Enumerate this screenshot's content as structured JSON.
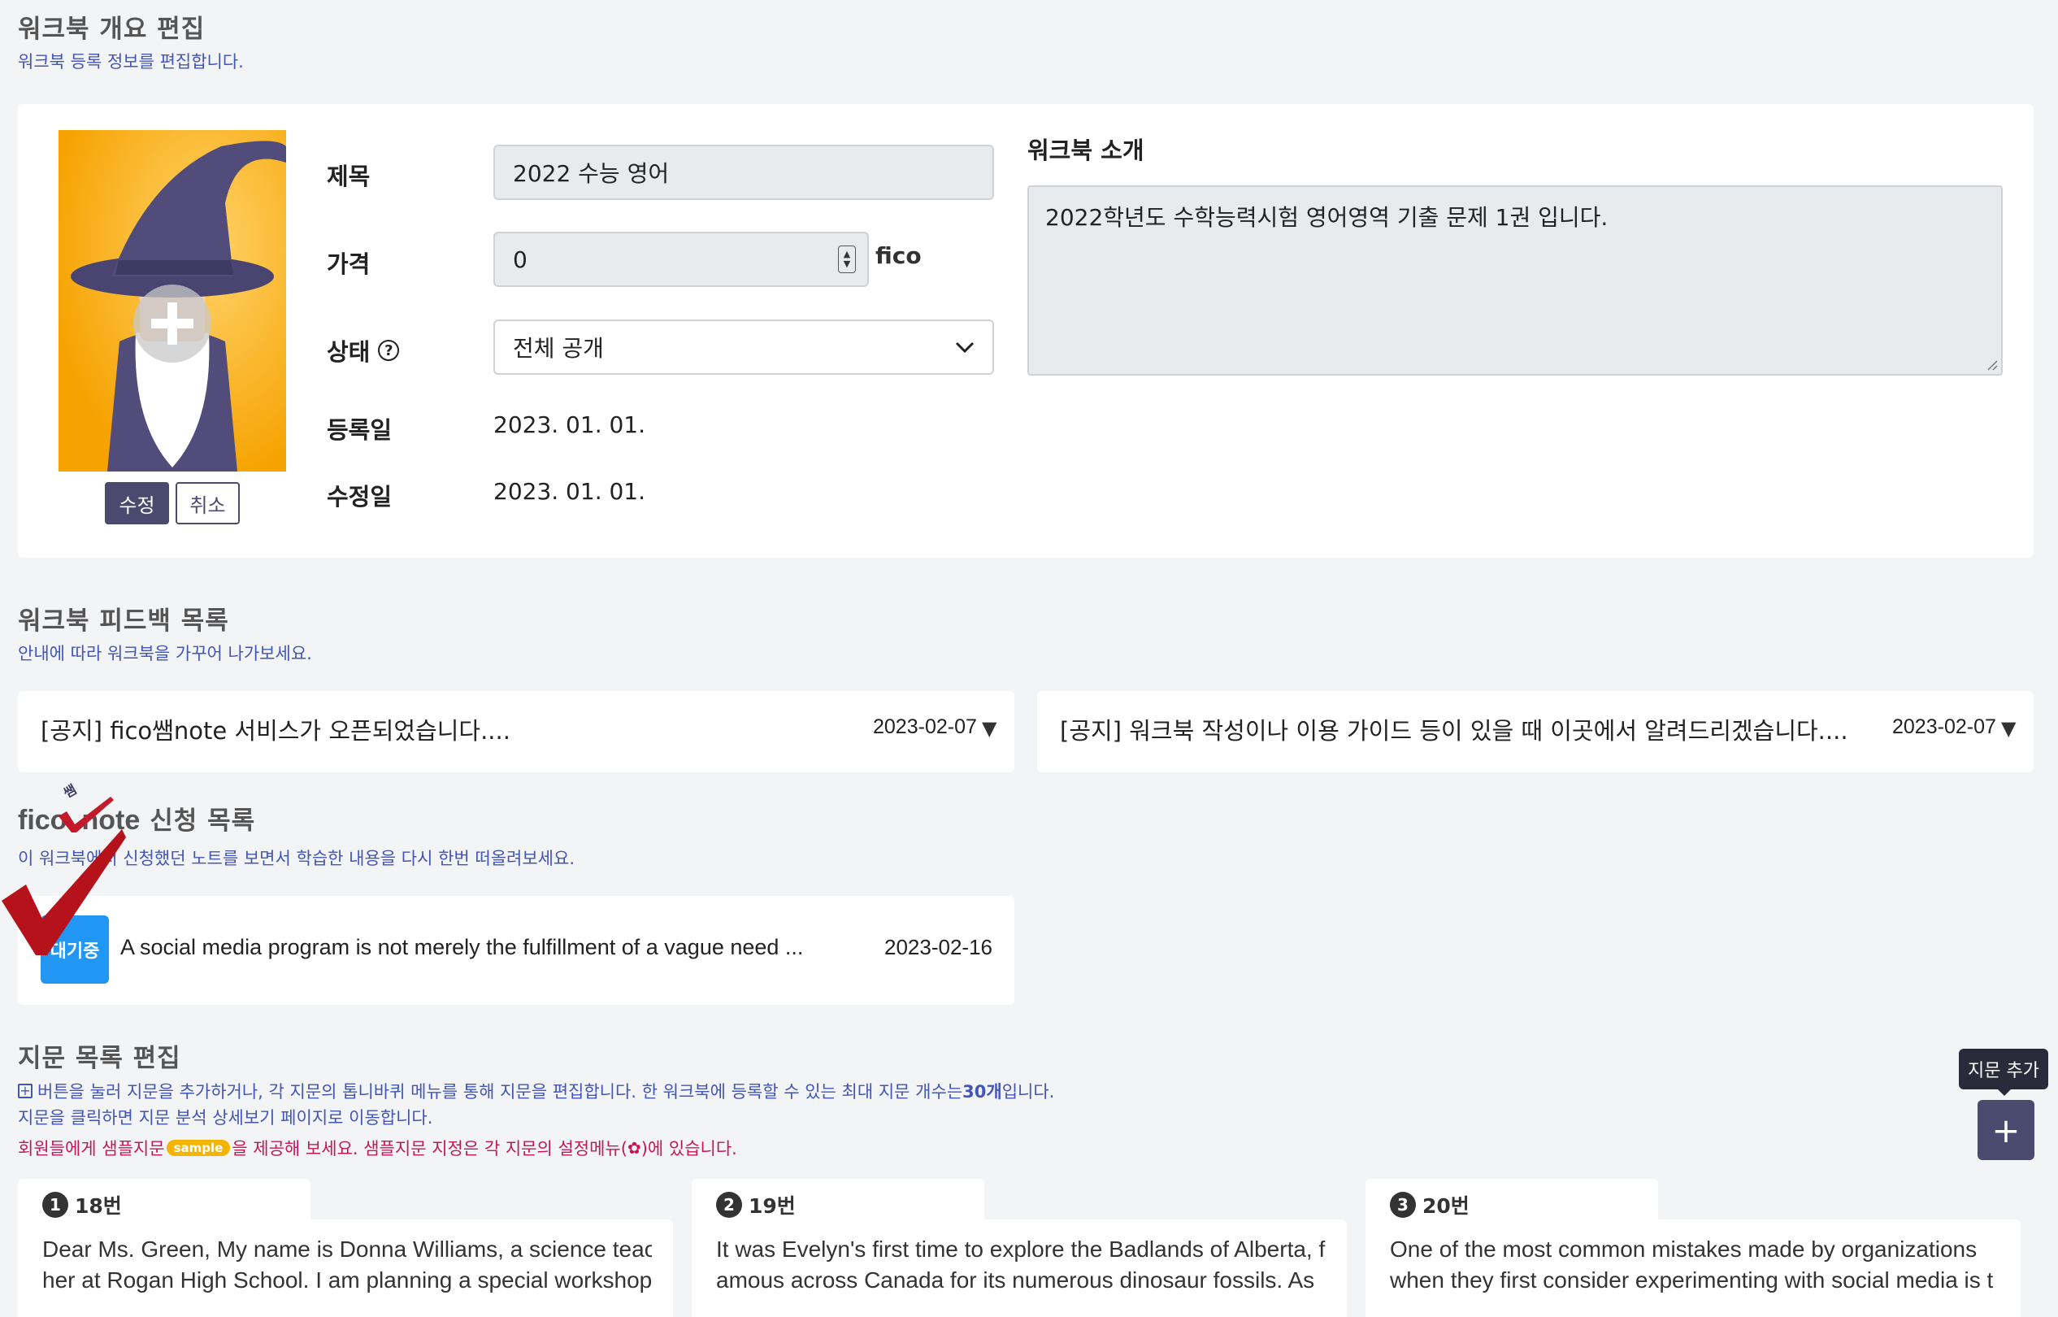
{
  "overview": {
    "title": "워크북 개요 편집",
    "subtitle": "워크북 등록 정보를 편집합니다.",
    "edit_button": "수정",
    "cancel_button": "취소",
    "labels": {
      "title": "제목",
      "price": "가격",
      "status": "상태",
      "registered": "등록일",
      "modified": "수정일",
      "intro": "워크북 소개"
    },
    "values": {
      "title": "2022 수능 영어",
      "price": "0",
      "price_unit": "fico",
      "status": "전체 공개",
      "registered": "2023. 01. 01.",
      "modified": "2023. 01. 01.",
      "intro": "2022학년도 수학능력시험 영어영역 기출 문제 1권 입니다."
    }
  },
  "feedback": {
    "title": "워크북 피드백 목록",
    "subtitle": "안내에 따라 워크북을 가꾸어 나가보세요.",
    "items": [
      {
        "text": "[공지] fico쌤note 서비스가 오픈되었습니다....",
        "date": "2023-02-07"
      },
      {
        "text": "[공지] 워크북 작성이나 이용 가이드 등이 있을 때 이곳에서 알려드리겠습니다....",
        "date": "2023-02-07"
      }
    ]
  },
  "note": {
    "brand_left": "fico",
    "brand_right": "note",
    "brand_mark": "쌤",
    "title_suffix": "신청 목록",
    "subtitle": "이 워크북에서 신청했던 노트를 보면서 학습한 내용을 다시 한번 떠올려보세요.",
    "items": [
      {
        "badge": "대기중",
        "text": "A social media program is not merely the fulfillment of a vague need ...",
        "date": "2023-02-16"
      }
    ]
  },
  "passages": {
    "title": "지문 목록 편집",
    "desc1_pre": "버튼을 눌러 지문을 추가하거나, 각 지문의 톱니바퀴 메뉴를 통해 지문을 편집합니다. 한 워크북에 등록할 수 있는 최대 지문 개수는 ",
    "desc1_bold": "30개",
    "desc1_post": "입니다.",
    "desc2": "지문을 클릭하면 지문 분석 상세보기 페이지로 이동합니다.",
    "desc3_pre": "회원들에게 샘플지문",
    "sample_badge": "sample",
    "desc3_mid": "을 제공해 보세요. 샘플지문 지정은 각 지문의 설정메뉴(",
    "desc3_post": ")에 있습니다.",
    "add_tooltip": "지문 추가",
    "add_button": "+",
    "cards": [
      {
        "num": "1",
        "label": "18번",
        "line1": "Dear Ms. Green, My name is Donna Williams, a science teac",
        "line2": "her at Rogan High School. I am planning a special workshop"
      },
      {
        "num": "2",
        "label": "19번",
        "line1": "It was Evelyn's first time to explore the Badlands of Alberta, f",
        "line2": "amous across Canada for its numerous dinosaur fossils. As"
      },
      {
        "num": "3",
        "label": "20번",
        "line1": "One of the most common mistakes made by organizations",
        "line2": "when they first consider experimenting with social media is t"
      }
    ]
  },
  "colors": {
    "accent": "#4355b5",
    "button_dark": "#4a4a6e",
    "badge_blue": "#2196f3",
    "sample_badge": "#f5b400",
    "check_red": "#b5121b",
    "magenta_text": "#c2185b"
  }
}
